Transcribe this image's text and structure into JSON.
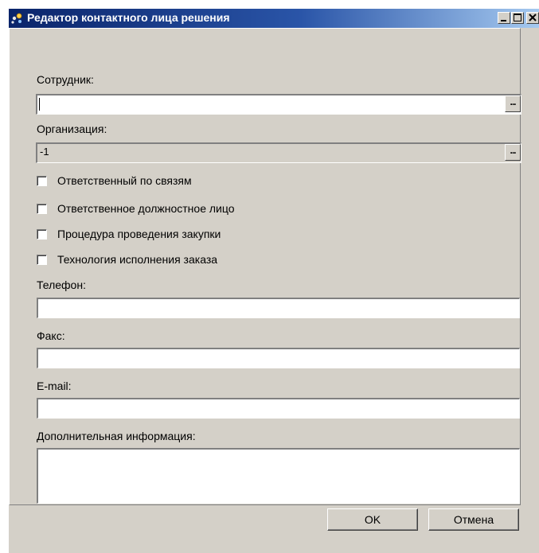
{
  "window": {
    "title": "Редактор контактного лица решения"
  },
  "form": {
    "employee_label": "Сотрудник:",
    "employee_value": "",
    "employee_button": "...",
    "organization_label": "Организация:",
    "organization_value": "-1",
    "organization_button": "...",
    "checkboxes": [
      {
        "label": "Ответственный по связям",
        "checked": false
      },
      {
        "label": "Ответственное должностное лицо",
        "checked": false
      },
      {
        "label": "Процедура проведения закупки",
        "checked": false
      },
      {
        "label": "Технология исполнения заказа",
        "checked": false
      }
    ],
    "phone_label": "Телефон:",
    "phone_value": "",
    "fax_label": "Факс:",
    "fax_value": "",
    "email_label": "E-mail:",
    "email_value": "",
    "extra_label": "Дополнительная информация:",
    "extra_value": ""
  },
  "buttons": {
    "ok": "OK",
    "cancel": "Отмена"
  }
}
